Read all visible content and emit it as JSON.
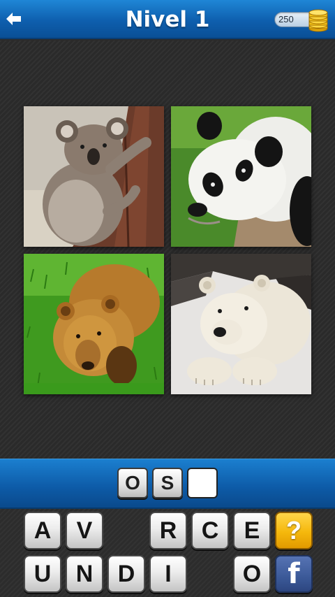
{
  "header": {
    "title": "Nivel 1",
    "coins": "250",
    "back_icon": "back-arrow-icon",
    "coin_icon": "coin-stack-icon"
  },
  "puzzle": {
    "photos": [
      {
        "subject": "koala"
      },
      {
        "subject": "panda"
      },
      {
        "subject": "brown-bear"
      },
      {
        "subject": "polar-bear"
      }
    ]
  },
  "answer": {
    "slots": [
      "O",
      "S",
      ""
    ]
  },
  "keyboard": {
    "row1": [
      "A",
      "V",
      "",
      "R",
      "C",
      "E"
    ],
    "row2": [
      "U",
      "N",
      "D",
      "I",
      "",
      "O"
    ],
    "hint_label": "?",
    "facebook_label": "f"
  },
  "colors": {
    "header_blue": "#0e5fae",
    "hint_gold": "#f5b80c",
    "facebook_blue": "#3b5998"
  }
}
